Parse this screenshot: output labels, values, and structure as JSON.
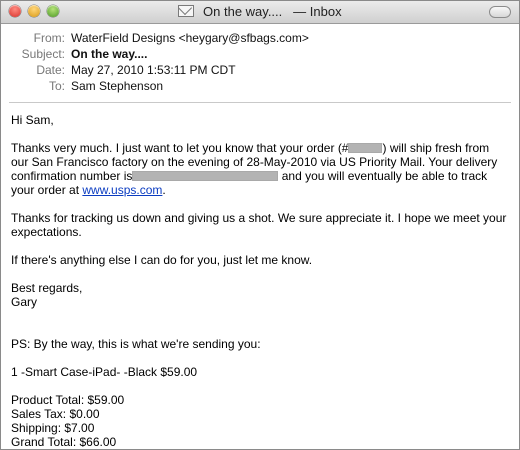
{
  "window": {
    "title": "On the way....",
    "folder": "Inbox",
    "title_separator": "— "
  },
  "headers": {
    "from_label": "From:",
    "from_value": "WaterField Designs <heygary@sfbags.com>",
    "subject_label": "Subject:",
    "subject_value": "On the way....",
    "date_label": "Date:",
    "date_value": "May 27, 2010 1:53:11 PM CDT",
    "to_label": "To:",
    "to_value": "Sam Stephenson"
  },
  "body": {
    "greeting": "Hi Sam,",
    "p1_a": "Thanks very much.  I just want to let you know that your order (#",
    "p1_b": ") will ship fresh from our San Francisco factory on the evening of 28-May-2010 via US Priority Mail.  Your delivery confirmation number is",
    "p1_c": " and you will eventually be able to track your order at ",
    "p1_link": "www.usps.com",
    "p1_d": ".",
    "p2": "Thanks for tracking us down and giving us a shot. We sure appreciate it. I hope we meet your expectations.",
    "p3": "If there's anything else I can do for you, just let me know.",
    "signoff": "Best regards,",
    "signature": "Gary",
    "ps": "PS:  By the way, this is what we're sending you:",
    "item": "1  -Smart Case-iPad- -Black  $59.00",
    "product_total": "Product Total: $59.00",
    "sales_tax": "Sales Tax: $0.00",
    "shipping": "Shipping: $7.00",
    "grand_total": "Grand Total: $66.00"
  }
}
